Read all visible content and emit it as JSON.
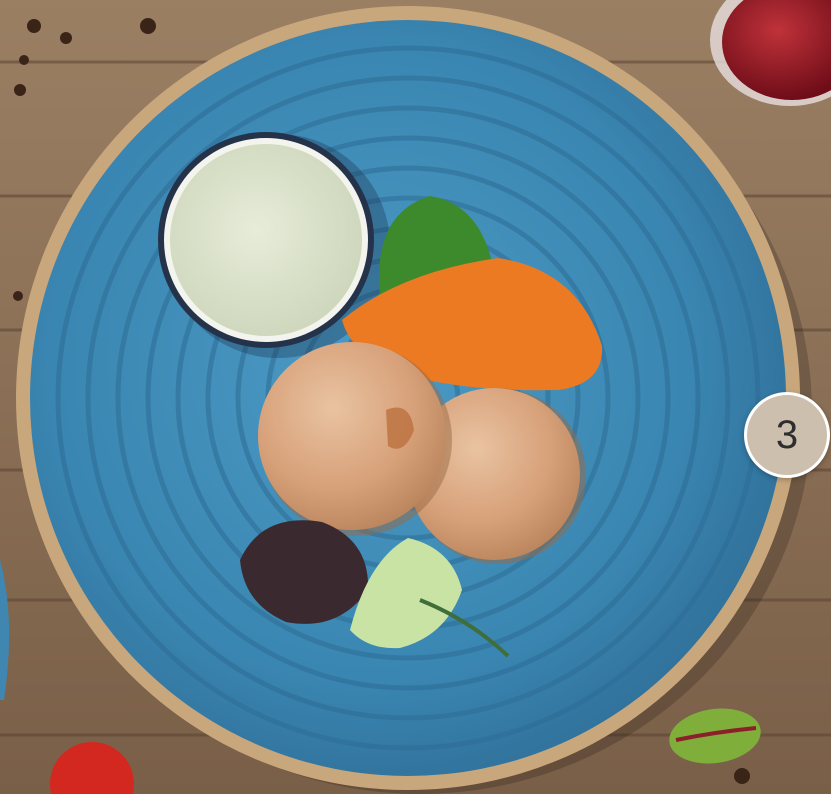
{
  "photo": {
    "subject": "fish-cakes-plate",
    "colors": {
      "table": "#8a6e55",
      "plate": "#3f8cb6",
      "plate_rim": "#c9a77c",
      "sauce": "#dfe4cf",
      "carrot_puree": "#ec7a22",
      "fish_cake": "#d9a67f"
    }
  },
  "badge": {
    "label": "3"
  }
}
